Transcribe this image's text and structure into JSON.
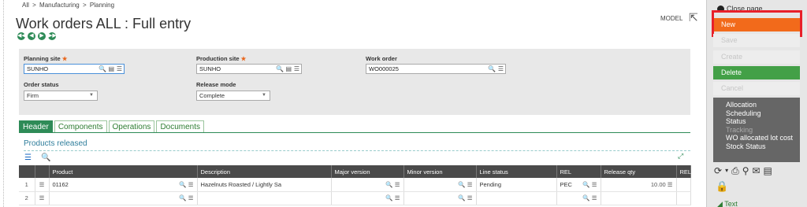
{
  "breadcrumb": {
    "items": [
      "All",
      "Manufacturing",
      "Planning"
    ],
    "sep": ">"
  },
  "header": {
    "title": "Work orders ALL : Full entry",
    "model_label": "MODEL",
    "nav": [
      "◀◀",
      "◀",
      "▶",
      "▶▶"
    ]
  },
  "form": {
    "planning_site": {
      "label": "Planning site",
      "req": "★",
      "value": "SUNHO"
    },
    "production_site": {
      "label": "Production site",
      "req": "★",
      "value": "SUNHO"
    },
    "work_order": {
      "label": "Work order",
      "value": "WO000025"
    },
    "order_status": {
      "label": "Order status",
      "value": "Firm"
    },
    "release_mode": {
      "label": "Release mode",
      "value": "Complete"
    }
  },
  "tabs": [
    "Header",
    "Components",
    "Operations",
    "Documents"
  ],
  "section": {
    "title": "Products released"
  },
  "grid": {
    "columns": [
      "",
      "",
      "Product",
      "Description",
      "Major version",
      "Minor version",
      "Line status",
      "REL",
      "Release qty",
      "REL"
    ],
    "rows": [
      {
        "num": "1",
        "product": "01162",
        "description": "Hazelnuts Roasted / Lightly Sa",
        "major": "",
        "minor": "",
        "status": "Pending",
        "rel": "PEC",
        "qty": "10.00"
      },
      {
        "num": "2",
        "product": "",
        "description": "",
        "major": "",
        "minor": "",
        "status": "",
        "rel": "",
        "qty": ""
      }
    ]
  },
  "sidebar": {
    "top_label": "Close page",
    "buttons": {
      "new": "New",
      "save": "Save",
      "create": "Create",
      "delete": "Delete",
      "cancel": "Cancel"
    },
    "actions": [
      "Allocation",
      "Scheduling",
      "Status",
      "Tracking",
      "WO allocated lot cost",
      "Stock Status"
    ],
    "text_section": "Text"
  },
  "colors": {
    "accent_green": "#2e8b57",
    "new_orange": "#f26a1b",
    "delete_green": "#43a047",
    "highlight_red": "#e8202a"
  }
}
